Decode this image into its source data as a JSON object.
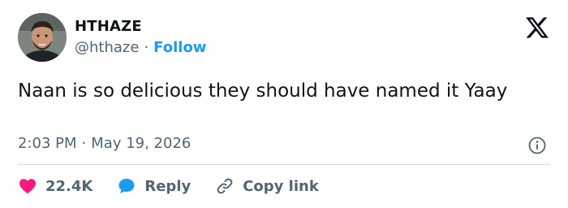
{
  "user": {
    "name": "HTHAZE",
    "handle": "@hthaze",
    "separator": "·",
    "follow_label": "Follow"
  },
  "tweet": {
    "text": "Naan is so delicious they should have named it Yaay",
    "time": "2:03 PM",
    "date_separator": "·",
    "date": "May 19, 2026"
  },
  "actions": {
    "likes_count": "22.4K",
    "reply_label": "Reply",
    "copy_link_label": "Copy link"
  },
  "icons": {
    "brand": "x-logo-icon",
    "info": "info-icon",
    "like": "heart-icon",
    "reply": "speech-bubble-icon",
    "copy": "link-icon"
  },
  "colors": {
    "accent": "#1d9bf0",
    "heart": "#f91880",
    "text": "#0f1419",
    "muted": "#536471"
  }
}
